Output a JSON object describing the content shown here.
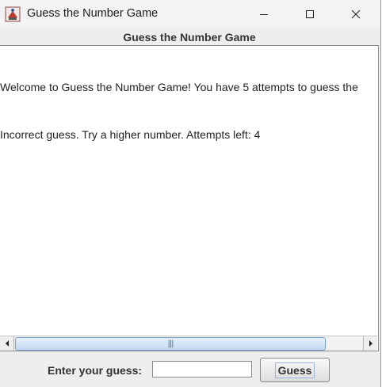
{
  "window": {
    "title": "Guess the Number Game",
    "icon": "java-cup-icon"
  },
  "header": {
    "title": "Guess the Number Game"
  },
  "output": {
    "lines": [
      "Welcome to Guess the Number Game! You have 5 attempts to guess the",
      "Incorrect guess. Try a higher number. Attempts left: 4"
    ]
  },
  "input_row": {
    "label": "Enter your guess:",
    "value": "",
    "button_label": "Guess"
  },
  "colors": {
    "window_bg": "#eeeeee",
    "titlebar_bg": "#f3f3f3",
    "scroll_thumb": "#c5d9ef",
    "focus_ring": "#9ab4d6"
  }
}
